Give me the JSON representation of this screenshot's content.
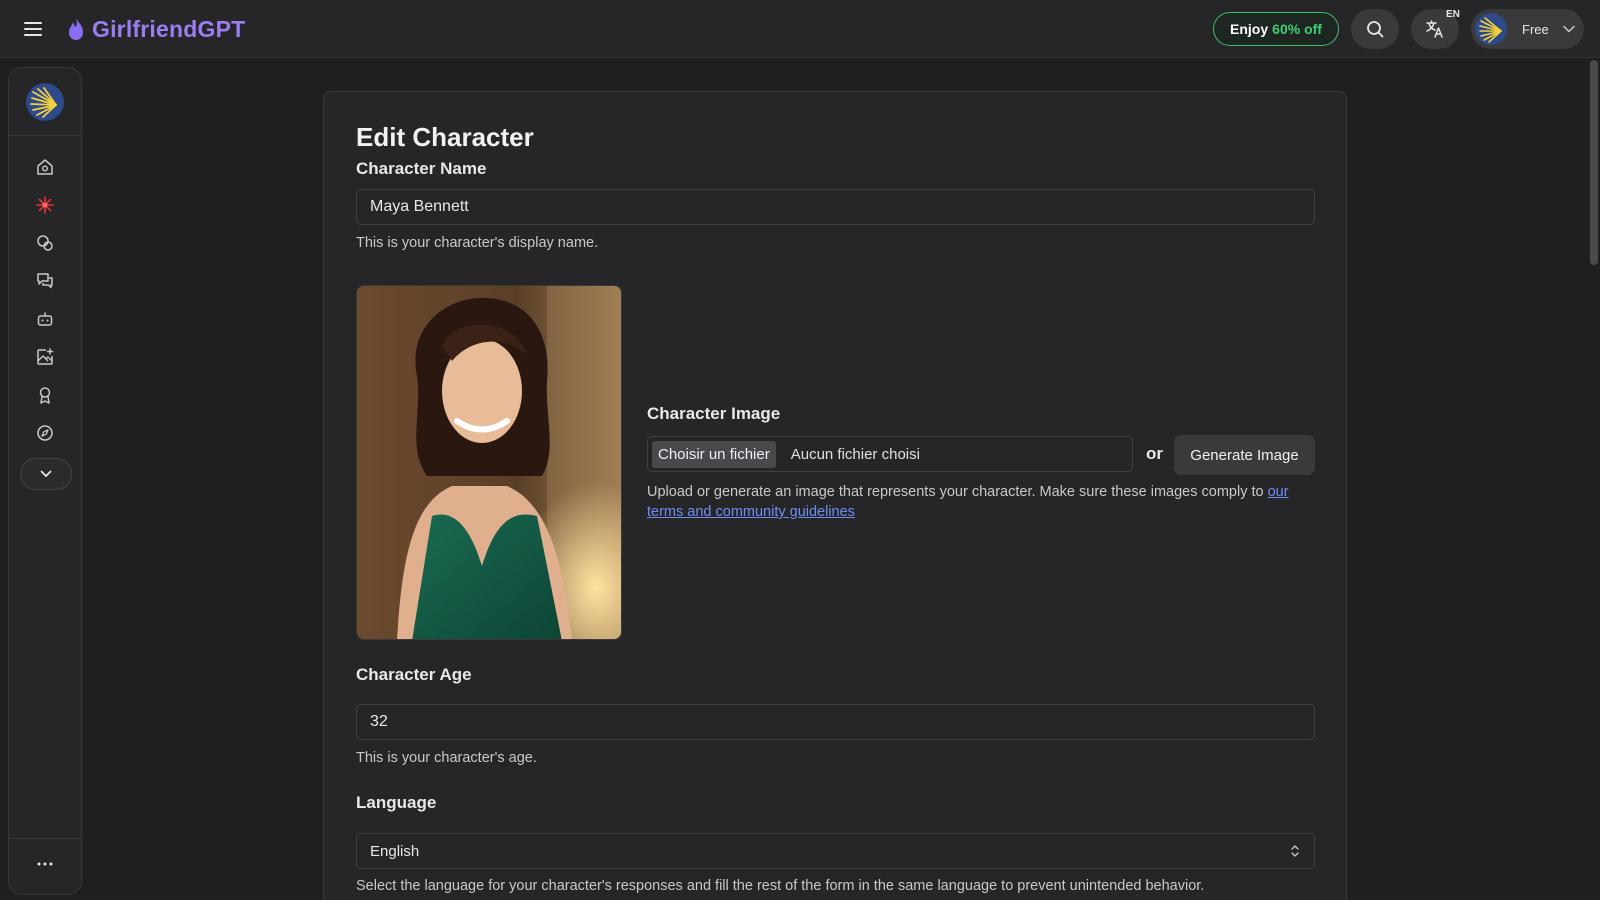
{
  "brand": {
    "name": "GirlfriendGPT",
    "color": "#9a7df0"
  },
  "header": {
    "promo_prefix": "Enjoy",
    "promo_accent": "60% off",
    "language_code": "EN",
    "plan_label": "Free"
  },
  "sidebar": {
    "items": [
      {
        "icon": "home-icon"
      },
      {
        "icon": "sparkle-icon"
      },
      {
        "icon": "characters-icon"
      },
      {
        "icon": "chat-icon"
      },
      {
        "icon": "robot-icon"
      },
      {
        "icon": "image-generate-icon"
      },
      {
        "icon": "award-icon"
      },
      {
        "icon": "explore-icon"
      }
    ],
    "expand_icon": "chevron-down-icon",
    "more_icon": "more-icon"
  },
  "form": {
    "title": "Edit Character",
    "name_label": "Character Name",
    "name_value": "Maya Bennett",
    "name_help": "This is your character's display name.",
    "image_label": "Character Image",
    "file_button": "Choisir un fichier",
    "file_status": "Aucun fichier choisi",
    "or_text": "or",
    "generate_button": "Generate Image",
    "image_help": "Upload or generate an image that represents your character. Make sure these images comply to",
    "image_help_link": "our terms and community guidelines",
    "age_label": "Character Age",
    "age_value": "32",
    "age_help": "This is your character's age.",
    "language_label": "Language",
    "language_value": "English",
    "language_help": "Select the language for your character's responses and fill the rest of the form in the same language to prevent unintended behavior."
  },
  "colors": {
    "background": "#1f1f21",
    "card": "#262628",
    "promo_accent": "#3fcf72",
    "link": "#6f8df5"
  }
}
